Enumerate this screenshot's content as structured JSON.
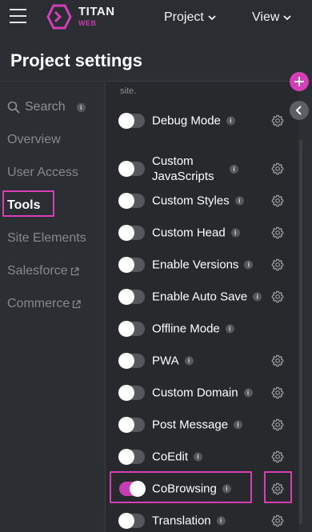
{
  "topbar": {
    "brand": "TITAN",
    "brand_sub": "WEB",
    "menu_project": "Project",
    "menu_view": "View"
  },
  "header": {
    "title": "Project settings"
  },
  "sidebar": {
    "search_label": "Search",
    "info": "i",
    "items": [
      {
        "label": "Overview"
      },
      {
        "label": "User Access"
      },
      {
        "label": "Tools",
        "active": true
      },
      {
        "label": "Site Elements"
      },
      {
        "label": "Salesforce",
        "external": true
      },
      {
        "label": "Commerce",
        "external": true
      }
    ]
  },
  "content": {
    "site_text": "site.",
    "info": "i",
    "rows": [
      {
        "label": "Debug Mode",
        "on": false,
        "gear": true
      },
      {
        "label": "Custom JavaScripts",
        "on": false,
        "gear": true
      },
      {
        "label": "Custom Styles",
        "on": false,
        "gear": true
      },
      {
        "label": "Custom Head",
        "on": false,
        "gear": true
      },
      {
        "label": "Enable Versions",
        "on": false,
        "gear": true
      },
      {
        "label": "Enable Auto Save",
        "on": false,
        "gear": true
      },
      {
        "label": "Offline Mode",
        "on": false,
        "gear": false
      },
      {
        "label": "PWA",
        "on": false,
        "gear": true
      },
      {
        "label": "Custom Domain",
        "on": false,
        "gear": true
      },
      {
        "label": "Post Message",
        "on": false,
        "gear": true
      },
      {
        "label": "CoEdit",
        "on": false,
        "gear": true
      },
      {
        "label": "CoBrowsing",
        "on": true,
        "gear": true
      },
      {
        "label": "Translation",
        "on": false,
        "gear": true
      }
    ]
  },
  "colors": {
    "accent": "#d93fb3",
    "toggle_off": "#55585d",
    "toggle_on": "#c93db2"
  }
}
